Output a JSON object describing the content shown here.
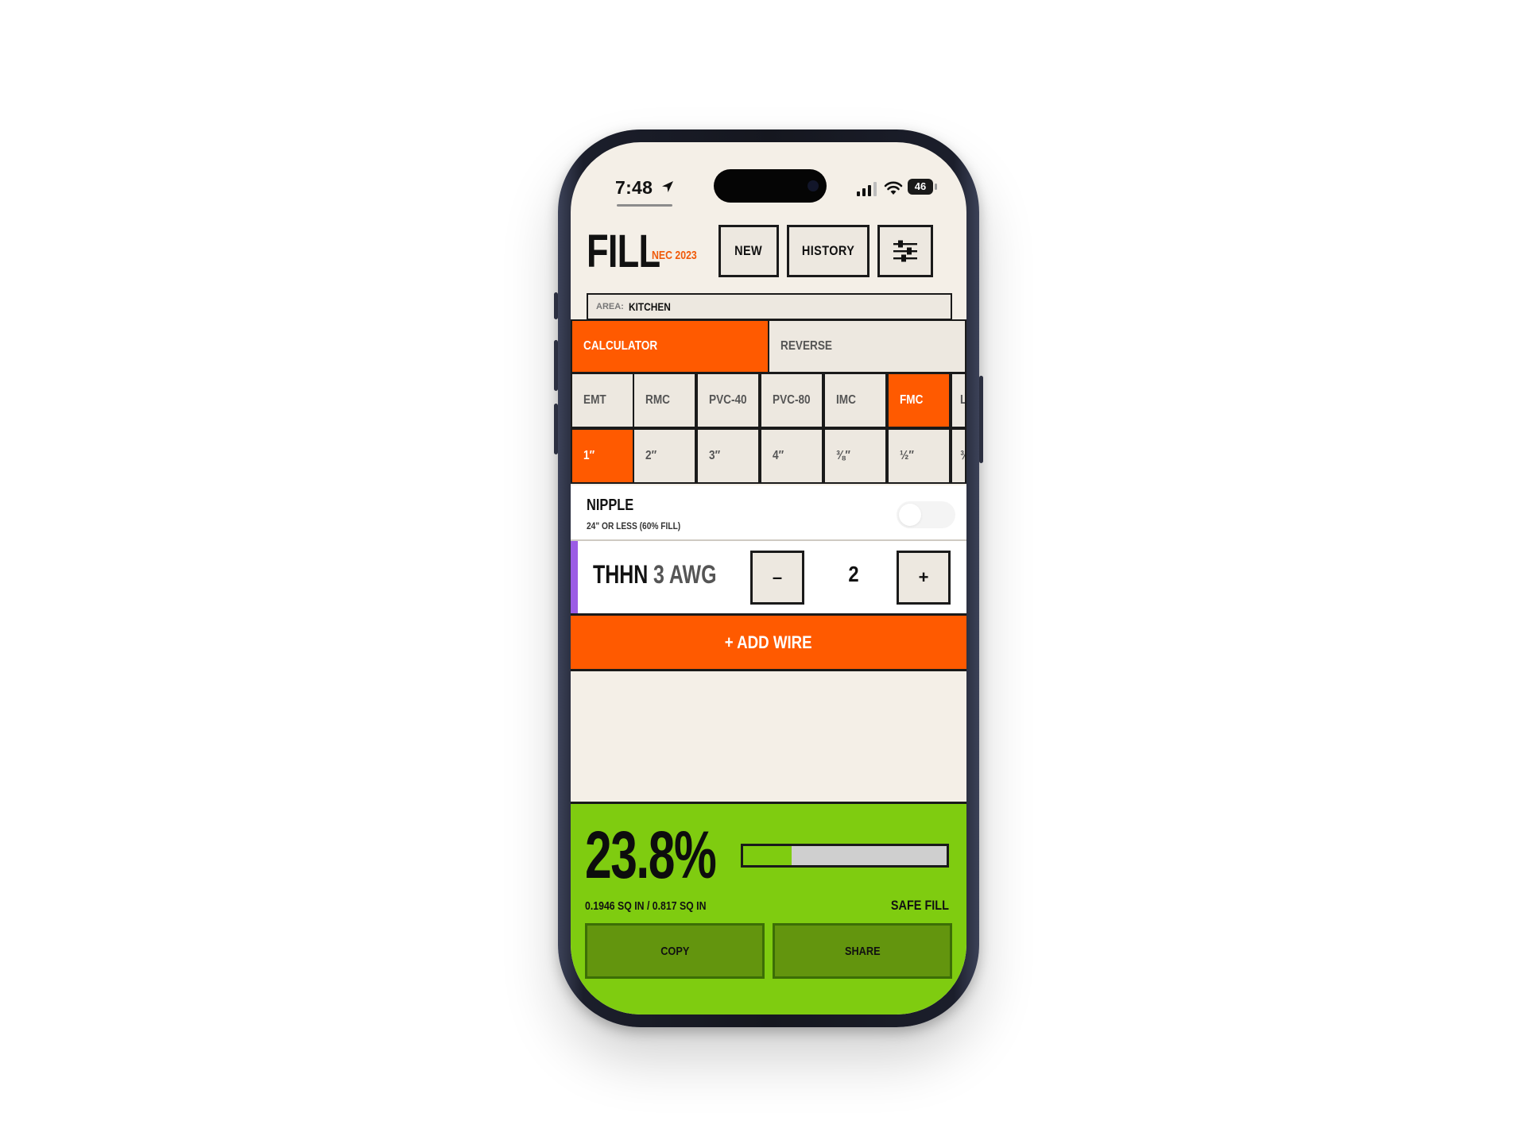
{
  "status": {
    "time": "7:48",
    "battery": "46"
  },
  "header": {
    "title": "FILL",
    "code_label": "NEC 2023",
    "new_label": "NEW",
    "history_label": "HISTORY",
    "settings_icon": "sliders-icon"
  },
  "area": {
    "label": "AREA:",
    "value": "KITCHEN"
  },
  "mode_tabs": [
    {
      "label": "CALCULATOR",
      "active": true
    },
    {
      "label": "REVERSE",
      "active": false
    }
  ],
  "conduit_types": [
    "EMT",
    "RMC",
    "PVC-40",
    "PVC-80",
    "IMC",
    "FMC",
    "L"
  ],
  "conduit_type_selected": "FMC",
  "trade_sizes": [
    "1″",
    "2″",
    "3″",
    "4″",
    "⅜″",
    "½″",
    "¾"
  ],
  "trade_size_selected": "1″",
  "nipple": {
    "title": "NIPPLE",
    "subtitle": "24\" OR LESS (60% FILL)",
    "enabled": false
  },
  "wire": {
    "type": "THHN",
    "size": "3 AWG",
    "count": "2",
    "minus_label": "–",
    "plus_label": "+",
    "accent": "#9b5de5"
  },
  "add_wire_label": "+ ADD WIRE",
  "result": {
    "percent": "23.8%",
    "fill_fraction": 0.238,
    "area_text": "0.1946 SQ IN / 0.817 SQ IN",
    "status": "SAFE FILL",
    "copy_label": "COPY",
    "share_label": "SHARE"
  },
  "colors": {
    "accent": "#ff5a00",
    "safe": "#7fcc10",
    "background": "#f4efe7"
  }
}
